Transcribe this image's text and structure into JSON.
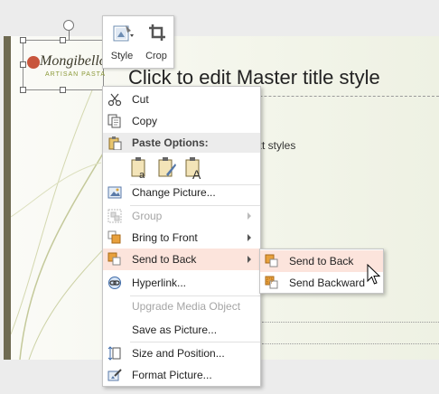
{
  "slide": {
    "title_placeholder": "Click to edit Master title style",
    "body_placeholder": "xt styles"
  },
  "logo": {
    "name": "Mongibello",
    "subtitle": "ARTISAN PASTA"
  },
  "mini_toolbar": {
    "style_label": "Style",
    "crop_label": "Crop"
  },
  "context_menu": {
    "cut": "Cut",
    "copy": "Copy",
    "paste_options": "Paste Options:",
    "change_picture": "Change Picture...",
    "group": "Group",
    "bring_to_front": "Bring to Front",
    "send_to_back": "Send to Back",
    "hyperlink": "Hyperlink...",
    "upgrade_media": "Upgrade Media Object",
    "save_as_picture": "Save as Picture...",
    "size_and_position": "Size and Position...",
    "format_picture": "Format Picture..."
  },
  "submenu": {
    "send_to_back": "Send to Back",
    "send_backward": "Send Backward"
  },
  "colors": {
    "hover": "#fce4dc",
    "accent": "#c8553d",
    "strip": "#6e6a51"
  }
}
